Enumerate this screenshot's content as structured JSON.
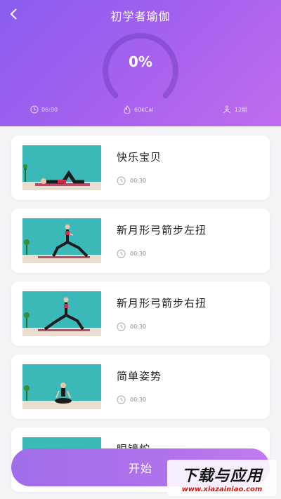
{
  "header": {
    "title": "初学者瑜伽",
    "progress": "0%",
    "progress_value": 0,
    "stats": {
      "time": "06:00",
      "calories": "60kCal",
      "groups": "12组"
    }
  },
  "exercises": [
    {
      "title": "快乐宝贝",
      "duration": "00:30"
    },
    {
      "title": "新月形弓箭步左扭",
      "duration": "00:30"
    },
    {
      "title": "新月形弓箭步右扭",
      "duration": "00:30"
    },
    {
      "title": "简单姿势",
      "duration": "00:30"
    },
    {
      "title": "眼镜蛇",
      "duration": ""
    }
  ],
  "start_button": {
    "label": "开始"
  },
  "watermark": {
    "main": "下载与应用",
    "sub": "www.xiazainiao.com"
  },
  "colors": {
    "header_gradient_start": "#8a5cf0",
    "header_gradient_end": "#c06ded",
    "button": "#b072ea",
    "thumb_bg": "#3bb8b8"
  }
}
